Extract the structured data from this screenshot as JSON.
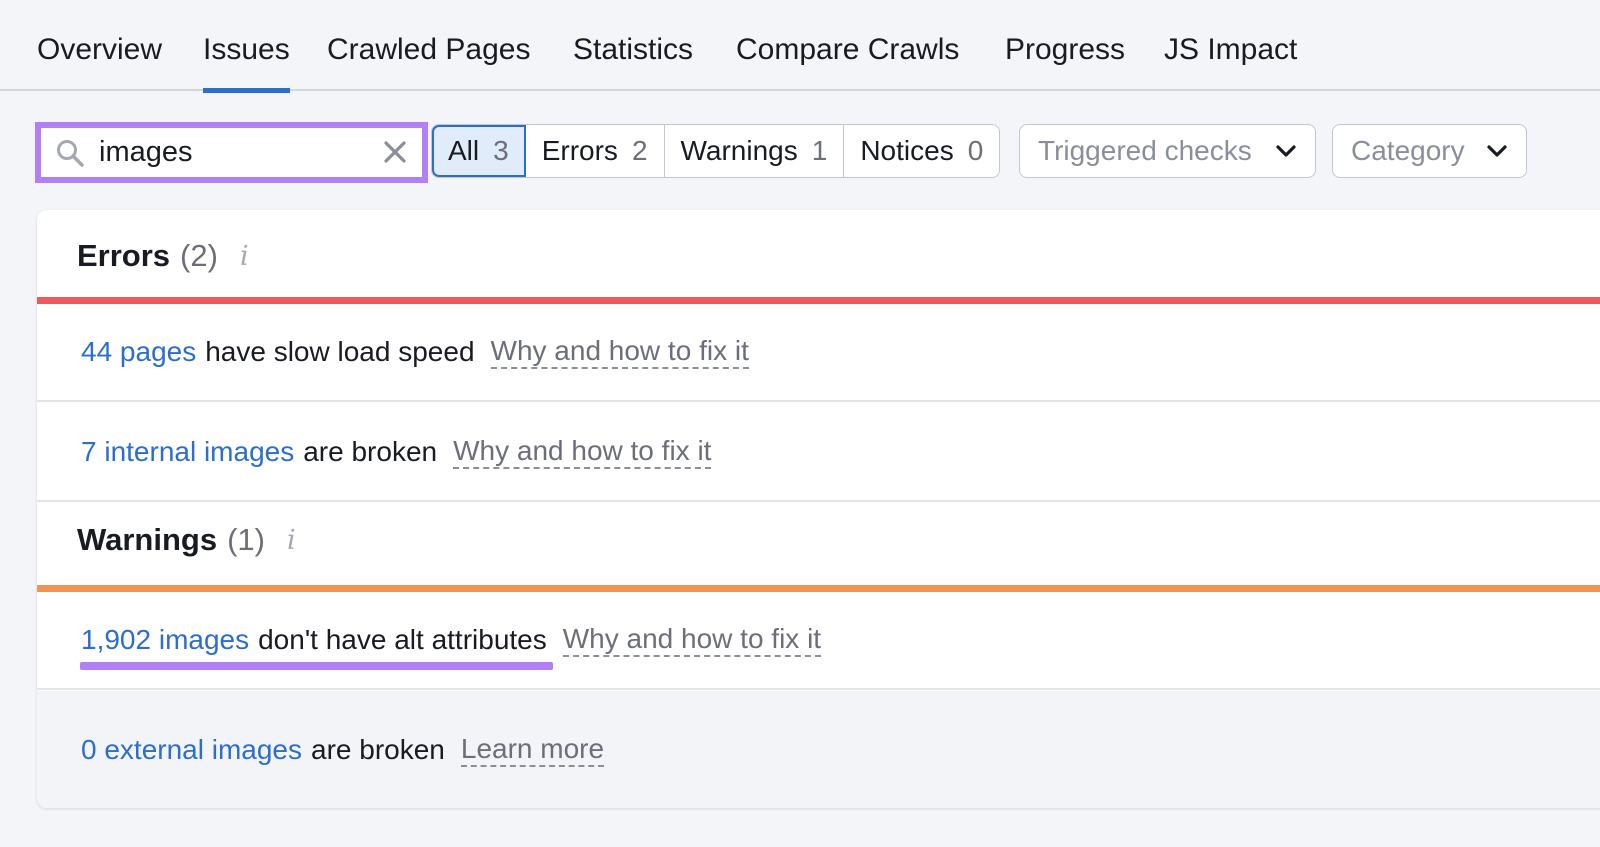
{
  "tabs": [
    {
      "label": "Overview",
      "active": false
    },
    {
      "label": "Issues",
      "active": true
    },
    {
      "label": "Crawled Pages",
      "active": false
    },
    {
      "label": "Statistics",
      "active": false
    },
    {
      "label": "Compare Crawls",
      "active": false
    },
    {
      "label": "Progress",
      "active": false
    },
    {
      "label": "JS Impact",
      "active": false
    }
  ],
  "search": {
    "value": "images",
    "icon": "search-icon",
    "clear_icon": "close-icon"
  },
  "filters": [
    {
      "label": "All",
      "count": "3",
      "active": true
    },
    {
      "label": "Errors",
      "count": "2",
      "active": false
    },
    {
      "label": "Warnings",
      "count": "1",
      "active": false
    },
    {
      "label": "Notices",
      "count": "0",
      "active": false
    }
  ],
  "dropdowns": {
    "triggered_checks": "Triggered checks",
    "category": "Category"
  },
  "sections": {
    "errors": {
      "title": "Errors",
      "count": "(2)",
      "info_icon": "i",
      "color": "#ef5a5f",
      "rows": [
        {
          "link": "44 pages",
          "text": "have slow load speed",
          "help": "Why and how to fix it"
        },
        {
          "link": "7 internal images",
          "text": "are broken",
          "help": "Why and how to fix it"
        }
      ]
    },
    "warnings": {
      "title": "Warnings",
      "count": "(1)",
      "info_icon": "i",
      "color": "#f19451",
      "rows": [
        {
          "link": "1,902 images",
          "text": "don't have alt attributes",
          "help": "Why and how to fix it"
        }
      ]
    },
    "passed": {
      "rows": [
        {
          "link": "0 external images",
          "text": "are broken",
          "help": "Learn more"
        }
      ]
    }
  },
  "colors": {
    "accent": "#2c6ecb",
    "highlight": "#b27ff5",
    "error": "#ef5a5f",
    "warning": "#f19451"
  }
}
